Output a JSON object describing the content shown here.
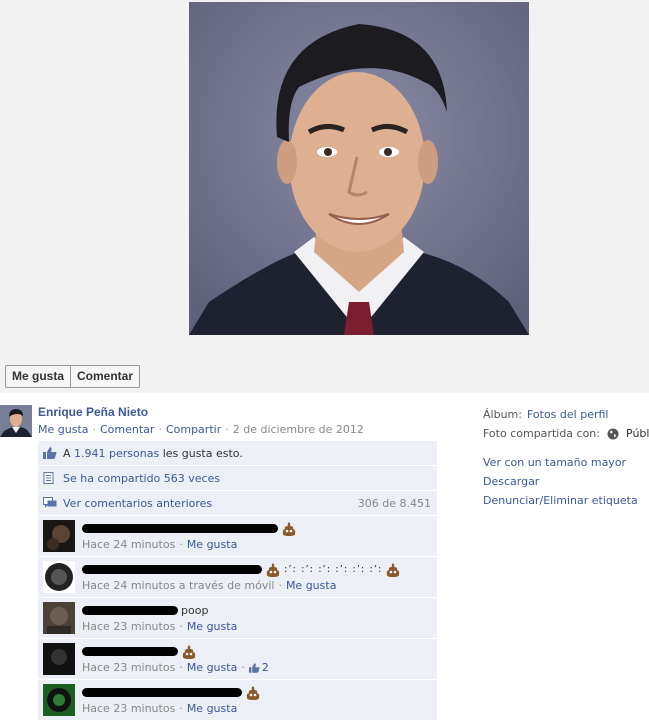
{
  "actions": {
    "like_label": "Me gusta",
    "comment_label": "Comentar"
  },
  "author": {
    "name": "Enrique Peña Nieto",
    "like": "Me gusta",
    "comment": "Comentar",
    "share": "Compartir",
    "date": "2 de diciembre de 2012"
  },
  "sidebar": {
    "album_label": "Álbum:",
    "album_value": "Fotos del perfil",
    "shared_with_label": "Foto compartida con:",
    "privacy_value": "Público",
    "view_larger": "Ver con un tamaño mayor",
    "download": "Descargar",
    "report": "Denunciar/Eliminar etiqueta"
  },
  "ufi": {
    "likes_prefix": "A ",
    "likes_count": "1.941 personas",
    "likes_suffix": " les gusta esto.",
    "shares": "Se ha compartido 563 veces",
    "view_previous": "Ver comentarios anteriores",
    "comment_count": "306 de 8.451"
  },
  "comments": [
    {
      "time": "Hace 24 minutos",
      "like": "Me gusta",
      "text": "",
      "dots": ""
    },
    {
      "time": "Hace 24 minutos a través de móvil",
      "like": "Me gusta",
      "text": "",
      "dots": ":’: :’: :’: :’: :’: :’:"
    },
    {
      "time": "Hace 23 minutos",
      "like": "Me gusta",
      "text": "poop",
      "dots": ""
    },
    {
      "time": "Hace 23 minutos",
      "like": "Me gusta",
      "text": "",
      "dots": "",
      "likes": "2"
    },
    {
      "time": "Hace 23 minutos",
      "like": "Me gusta",
      "text": "",
      "dots": ""
    }
  ],
  "icons": {
    "thumb": "thumbs-up-icon",
    "share": "share-icon",
    "comments": "comments-icon",
    "globe": "globe-icon",
    "poop": "poop-emoticon"
  },
  "colors": {
    "link": "#3b5998",
    "ufi_bg": "#eceff5",
    "stage_bg": "#f2f2f2"
  }
}
